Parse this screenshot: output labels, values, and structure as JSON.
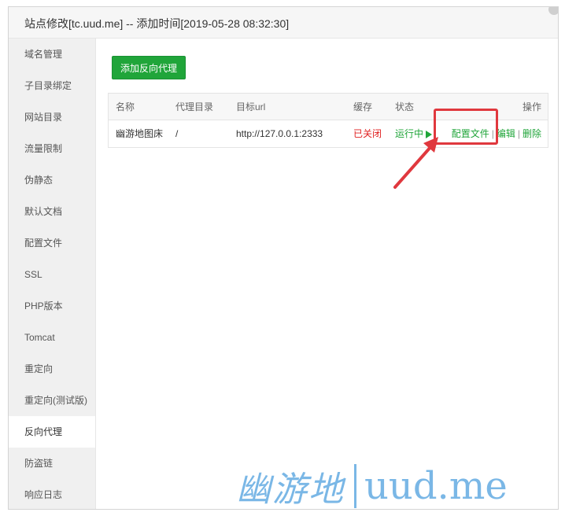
{
  "window": {
    "title": "站点修改[tc.uud.me] -- 添加时间[2019-05-28 08:32:30]"
  },
  "sidebar": {
    "items": [
      {
        "label": "域名管理"
      },
      {
        "label": "子目录绑定"
      },
      {
        "label": "网站目录"
      },
      {
        "label": "流量限制"
      },
      {
        "label": "伪静态"
      },
      {
        "label": "默认文档"
      },
      {
        "label": "配置文件"
      },
      {
        "label": "SSL"
      },
      {
        "label": "PHP版本"
      },
      {
        "label": "Tomcat"
      },
      {
        "label": "重定向"
      },
      {
        "label": "重定向(测试版)"
      },
      {
        "label": "反向代理",
        "active": true
      },
      {
        "label": "防盗链"
      },
      {
        "label": "响应日志"
      }
    ]
  },
  "main": {
    "add_button": "添加反向代理",
    "table": {
      "headers": {
        "name": "名称",
        "dir": "代理目录",
        "url": "目标url",
        "cache": "缓存",
        "state": "状态",
        "op": "操作"
      },
      "rows": [
        {
          "name": "幽游地图床",
          "dir": "/",
          "url": "http://127.0.0.1:2333",
          "cache": "已关闭",
          "state": "运行中",
          "op_config": "配置文件",
          "op_edit": "编辑",
          "op_delete": "删除",
          "op_sep": "|"
        }
      ]
    }
  },
  "watermark": {
    "cn": "幽游地",
    "en": "uud.me"
  },
  "colors": {
    "accent_green": "#20a53a",
    "status_red": "#e02020",
    "annotation_red": "#e0383e",
    "watermark_blue": "#7ab7e6"
  }
}
